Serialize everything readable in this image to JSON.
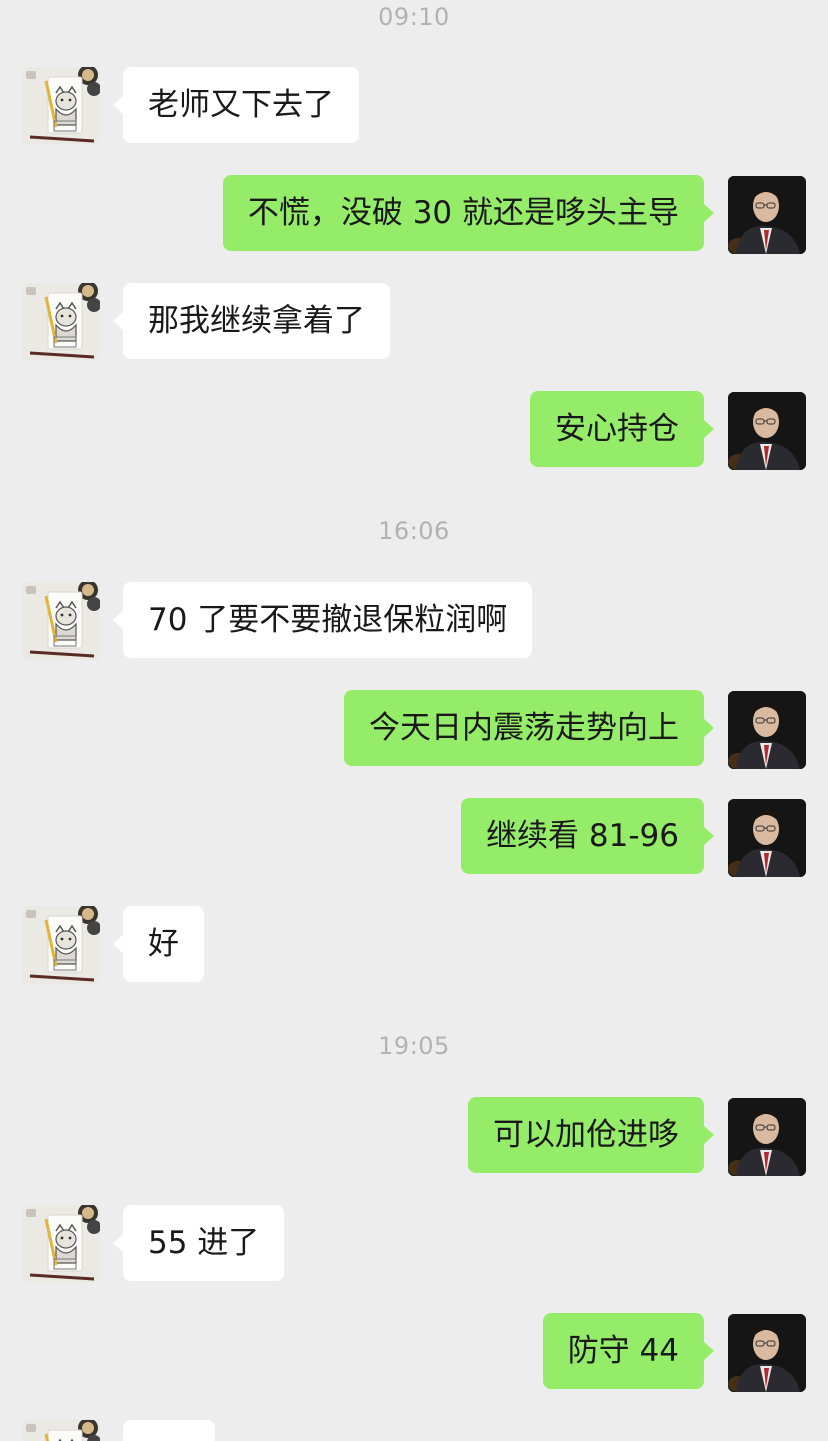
{
  "chat": {
    "timestamps": [
      "09:10",
      "16:06",
      "19:05"
    ],
    "messages": [
      {
        "side": "left",
        "text": "老师又下去了"
      },
      {
        "side": "right",
        "text": "不慌，没破 30 就还是哆头主导"
      },
      {
        "side": "left",
        "text": "那我继续拿着了"
      },
      {
        "side": "right",
        "text": "安心持仓"
      },
      {
        "side": "left",
        "text": "70 了要不要撤退保粒润啊"
      },
      {
        "side": "right",
        "text": "今天日内震荡走势向上"
      },
      {
        "side": "right",
        "text": "继续看 81-96"
      },
      {
        "side": "left",
        "text": "好"
      },
      {
        "side": "right",
        "text": "可以加伧进哆"
      },
      {
        "side": "left",
        "text": "55 进了"
      },
      {
        "side": "right",
        "text": "防守 44"
      }
    ]
  },
  "colors": {
    "background": "#ededed",
    "bubble_self": "#95ec69",
    "bubble_other": "#ffffff",
    "text": "#191919",
    "timestamp": "#b2b2b2"
  },
  "icons": {
    "other_avatar": "cat-sketch-avatar",
    "self_avatar": "man-in-suit-avatar"
  }
}
